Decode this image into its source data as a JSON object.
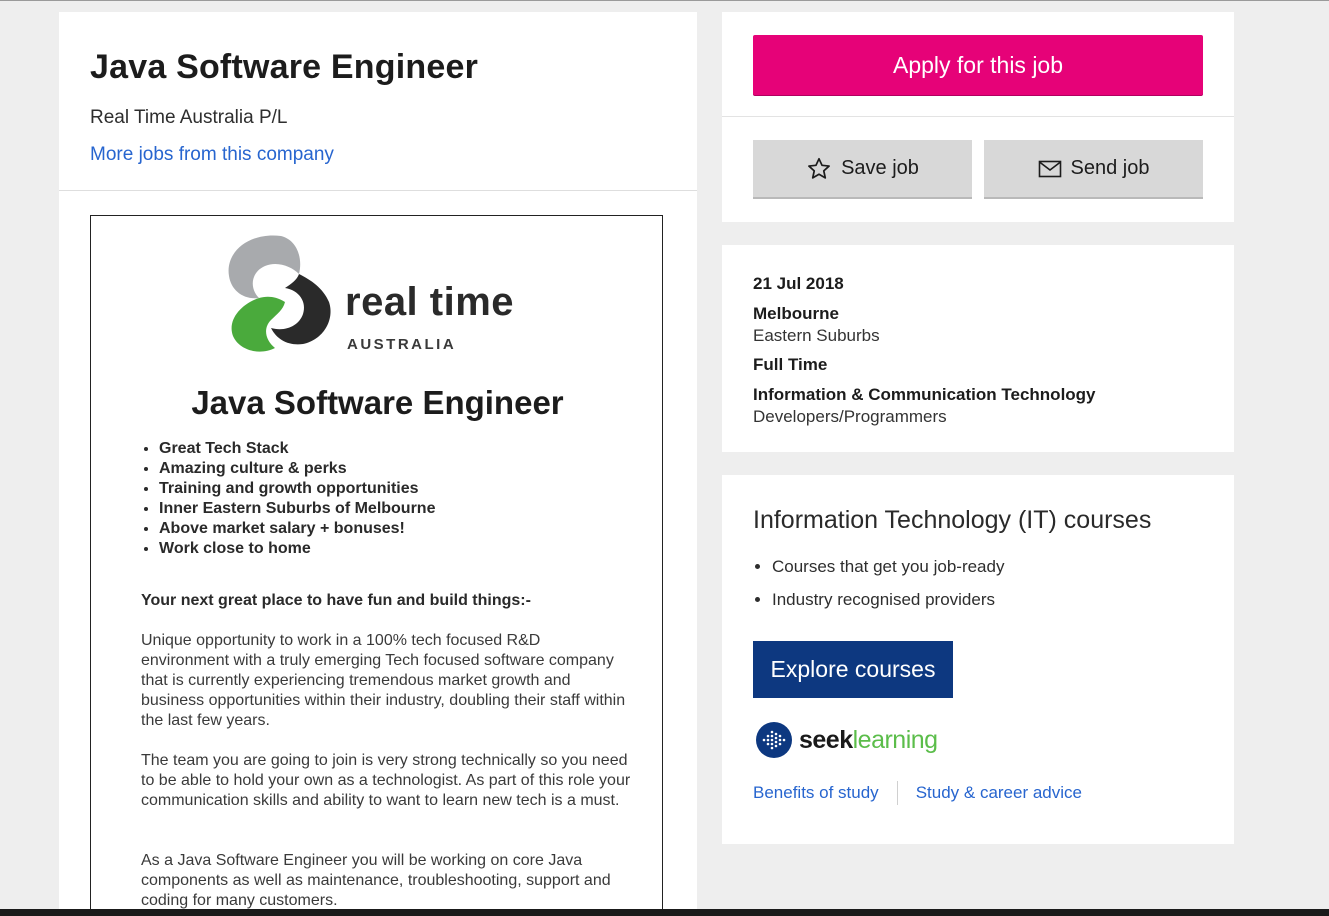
{
  "job": {
    "title": "Java Software Engineer",
    "company": "Real Time Australia P/L",
    "more_jobs_link": "More jobs from this company"
  },
  "ad": {
    "logo_wordmark": "real time",
    "logo_subtext": "AUSTRALIA",
    "title": "Java Software Engineer",
    "bullets": [
      "Great Tech Stack",
      "Amazing culture & perks",
      "Training and growth opportunities",
      "Inner Eastern Suburbs of Melbourne",
      "Above market salary + bonuses!",
      "Work close to home"
    ],
    "heading": "Your next great place to have fun and build things:-",
    "paragraphs": [
      "Unique opportunity to work in a 100% tech focused R&D environment with a truly emerging Tech focused software company that is currently experiencing tremendous market growth and business opportunities within their industry, doubling their staff within the last few years.",
      "The team you are going to join is very strong technically so you need to be able to hold your own as a technologist. As part of this role your communication skills and ability to want to learn new tech is a must.",
      "As a Java Software Engineer you will be working on core Java components as well as maintenance, troubleshooting, support and coding for many customers."
    ]
  },
  "actions": {
    "apply_label": "Apply for this job",
    "save_label": "Save job",
    "send_label": "Send job",
    "save_icon": "star-icon",
    "send_icon": "envelope-icon",
    "apply_color": "#e60278"
  },
  "details": {
    "date": "21 Jul 2018",
    "location": "Melbourne",
    "area": "Eastern Suburbs",
    "work_type": "Full Time",
    "classification": "Information & Communication Technology",
    "sub_classification": "Developers/Programmers"
  },
  "courses": {
    "title": "Information Technology (IT) courses",
    "points": [
      "Courses that get you job-ready",
      "Industry recognised providers"
    ],
    "explore_label": "Explore courses",
    "brand_seek": "seek",
    "brand_learning": "learning",
    "link_benefits": "Benefits of study",
    "link_advice": "Study & career advice",
    "explore_color": "#0d3880"
  }
}
